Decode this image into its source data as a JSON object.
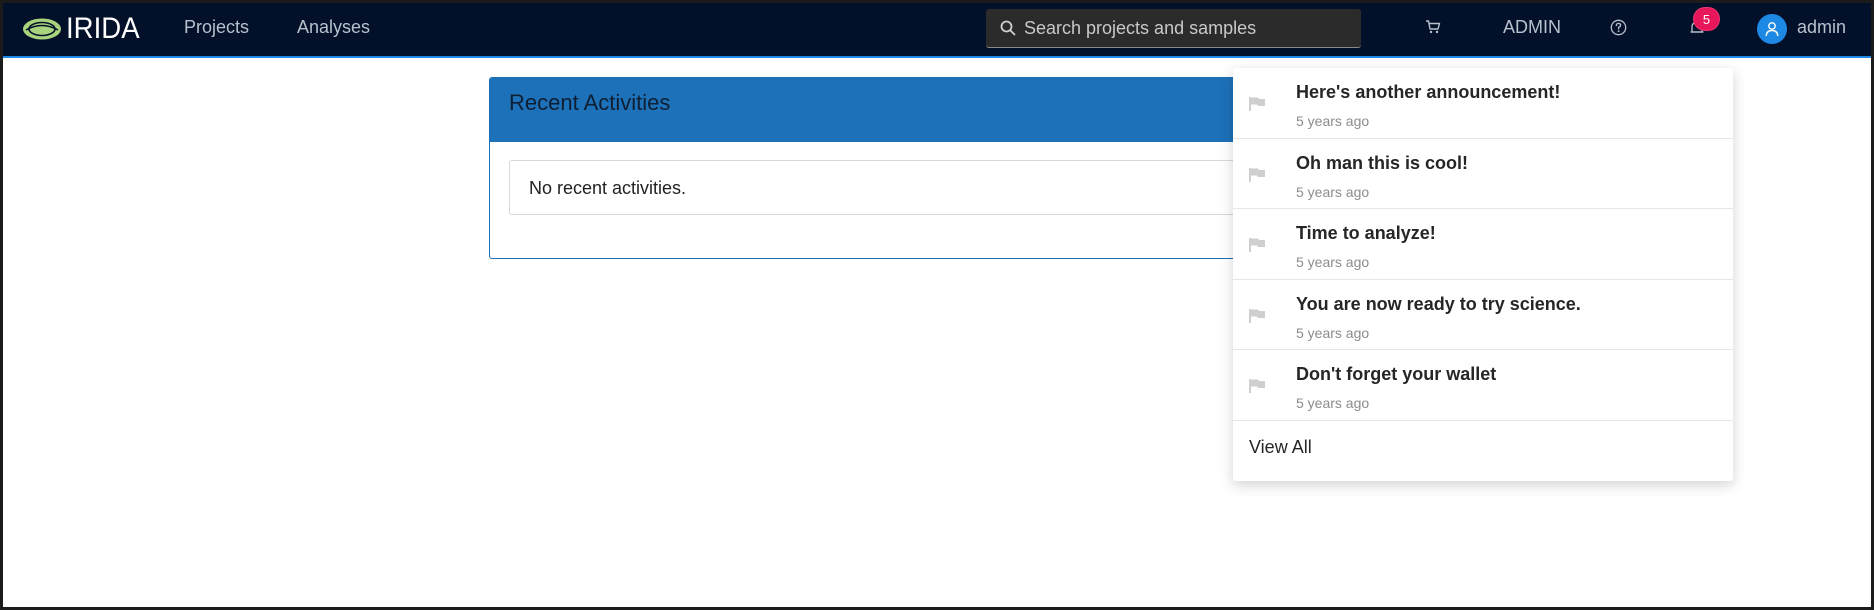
{
  "app": {
    "logo_text": "IRIDA"
  },
  "nav": {
    "links": [
      "Projects",
      "Analyses"
    ],
    "search_placeholder": "Search projects and samples",
    "admin_label": "ADMIN",
    "notification_count": "5",
    "user_label": "admin"
  },
  "card": {
    "title": "Recent Activities",
    "empty_message": "No recent activities."
  },
  "notifications": {
    "items": [
      {
        "title": "Here's another announcement!",
        "time": "5 years ago"
      },
      {
        "title": "Oh man this is cool!",
        "time": "5 years ago"
      },
      {
        "title": "Time to analyze!",
        "time": "5 years ago"
      },
      {
        "title": "You are now ready to try science.",
        "time": "5 years ago"
      },
      {
        "title": "Don't forget your wallet",
        "time": "5 years ago"
      }
    ],
    "view_all_label": "View All"
  },
  "icons": {
    "search": "search-icon",
    "cart": "cart-icon",
    "help": "question-circle-icon",
    "bell": "bell-icon",
    "user": "user-icon",
    "flag": "flag-icon"
  },
  "colors": {
    "nav_bg": "#03102a",
    "accent": "#1e88e5",
    "card_header": "#1d71b8",
    "badge": "#e8165a"
  }
}
